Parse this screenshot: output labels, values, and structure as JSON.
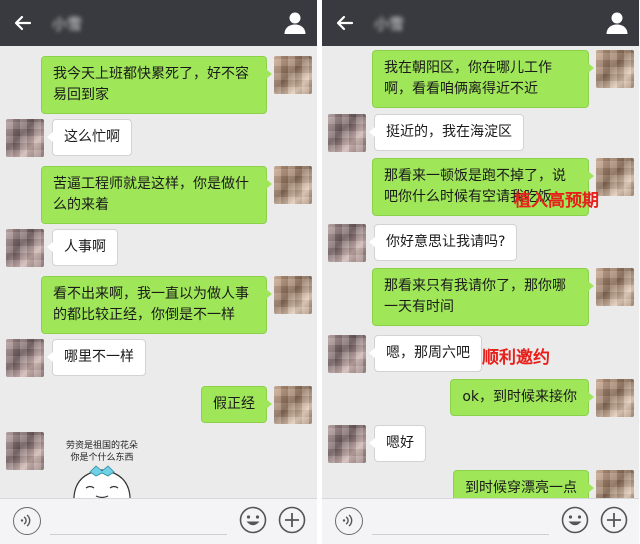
{
  "left": {
    "title": "小雪",
    "messages": [
      {
        "side": "sent",
        "text": "我今天上班都快累死了，好不容易回到家"
      },
      {
        "side": "recv",
        "text": "这么忙啊"
      },
      {
        "side": "sent",
        "text": "苦逼工程师就是这样，你是做什么的来着"
      },
      {
        "side": "recv",
        "text": "人事啊"
      },
      {
        "side": "sent",
        "text": "看不出来啊，我一直以为做人事的都比较正经，你倒是不一样"
      },
      {
        "side": "recv",
        "text": "哪里不一样"
      },
      {
        "side": "sent",
        "text": "假正经"
      }
    ],
    "sticker": {
      "line1": "劳资是祖国的花朵",
      "line2": "你是个什么东西"
    }
  },
  "right": {
    "title": "小雪",
    "messages": [
      {
        "side": "sent",
        "text": "我在朝阳区，你在哪儿工作啊，看看咱俩离得近不近"
      },
      {
        "side": "recv",
        "text": "挺近的，我在海淀区"
      },
      {
        "side": "sent",
        "text": "那看来一顿饭是跑不掉了，说吧你什么时候有空请我吃饭"
      },
      {
        "side": "recv",
        "text": "你好意思让我请吗?"
      },
      {
        "side": "sent",
        "text": "那看来只有我请你了，那你哪一天有时间"
      },
      {
        "side": "recv",
        "text": "嗯，那周六吧"
      },
      {
        "side": "sent",
        "text": "ok，到时候来接你"
      },
      {
        "side": "recv",
        "text": "嗯好"
      },
      {
        "side": "sent",
        "text": "到时候穿漂亮一点"
      }
    ],
    "annotations": [
      "植入高预期",
      "顺利邀约"
    ]
  },
  "icons": {
    "back": "back-arrow-icon",
    "profile": "person-icon",
    "voice": "voice-icon",
    "emoji": "emoji-icon",
    "more": "plus-icon"
  },
  "colors": {
    "topbar": "#393a3f",
    "sent_bubble": "#9fe658",
    "recv_bubble": "#ffffff",
    "chat_bg": "#ebebeb",
    "annotation": "#e8201b"
  }
}
